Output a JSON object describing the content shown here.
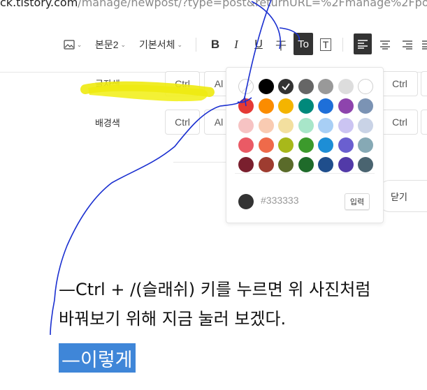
{
  "browser": {
    "url_host": "ck.tistory.com",
    "url_path": "/manage/newpost/?type=post&returnURL=%2Fmanage%2Fpo"
  },
  "toolbar": {
    "image_icon": "image-icon",
    "paragraph_label": "본문2",
    "font_label": "기본서체",
    "bold": "B",
    "italic": "I",
    "underline": "U",
    "strike": "干",
    "text_color": "To",
    "text_bg": "T",
    "align_icons": [
      "align-left-icon",
      "align-center-icon",
      "align-right-icon"
    ]
  },
  "shortcut_rows": [
    {
      "label": "글자색",
      "keys": [
        "Ctrl",
        "Al"
      ],
      "right_key": "Ctrl"
    },
    {
      "label": "배경색",
      "keys": [
        "Ctrl",
        "Al"
      ],
      "right_key": "Ctrl"
    }
  ],
  "close_label": "닫기",
  "palette": {
    "colors": [
      [
        "#ffffff",
        "#000000",
        "#333333",
        "#666666",
        "#999999",
        "#dddddd",
        "#ffffff"
      ],
      [
        "#e53935",
        "#fb8c00",
        "#f4b400",
        "#00897b",
        "#1e6fd9",
        "#8e44ad",
        "#7b93b4"
      ],
      [
        "#f6c3c3",
        "#f9cbb2",
        "#f3df9f",
        "#a8e6c9",
        "#a8cff5",
        "#cbc4f2",
        "#c9d3e6"
      ],
      [
        "#ea5a65",
        "#ef6a4a",
        "#a8b81a",
        "#3c9a2c",
        "#1d8ed6",
        "#6a5fd0",
        "#86a9b5"
      ],
      [
        "#7a1f2e",
        "#9e3c30",
        "#5a6b2a",
        "#1f6b2a",
        "#1f4e8c",
        "#523aa8",
        "#4a6470"
      ]
    ],
    "selected_color": "#333333",
    "current_color": "#333333",
    "hex_value": "#333333",
    "apply_label": "입력"
  },
  "content": {
    "line1": "—Ctrl + /(슬래쉬) 키를 누르면 위 사진처럼",
    "line2": "바꿔보기 위해 지금 눌러 보겠다.",
    "selected": "—이렇게"
  }
}
